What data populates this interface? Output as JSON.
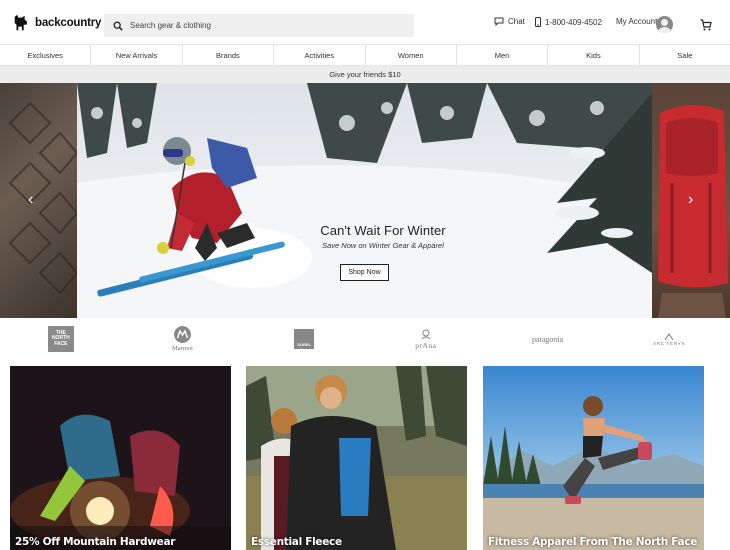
{
  "header": {
    "logo_text": "backcountry",
    "search_placeholder": "Search gear & clothing",
    "chat_label": "Chat",
    "phone_label": "1-800-409-4502",
    "account_label": "My Account"
  },
  "nav": {
    "items": [
      "Exclusives",
      "New Arrivals",
      "Brands",
      "Activities",
      "Women",
      "Men",
      "Kids",
      "Sale"
    ]
  },
  "promo": {
    "text": "Give your friends $10"
  },
  "hero": {
    "title": "Can't Wait For Winter",
    "subtitle": "Save Now on Winter Gear & Apparel",
    "cta_label": "Shop Now",
    "prev_icon": "‹",
    "next_icon": "›"
  },
  "brands": {
    "tnf": "THE NORTH FACE",
    "marmot": "Marmot",
    "sorel": "SOREL",
    "prana": "prAna",
    "patagonia": "patagonia",
    "arcteryx": "ARC'TERYX"
  },
  "tiles": [
    {
      "caption": "25% Off Mountain Hardwear"
    },
    {
      "caption": "Essential Fleece"
    },
    {
      "caption": "Fitness Apparel From The North Face"
    }
  ],
  "colors": {
    "nav_border": "#e4e4e4",
    "promo_bg": "#ececec",
    "search_bg": "#efefef"
  }
}
